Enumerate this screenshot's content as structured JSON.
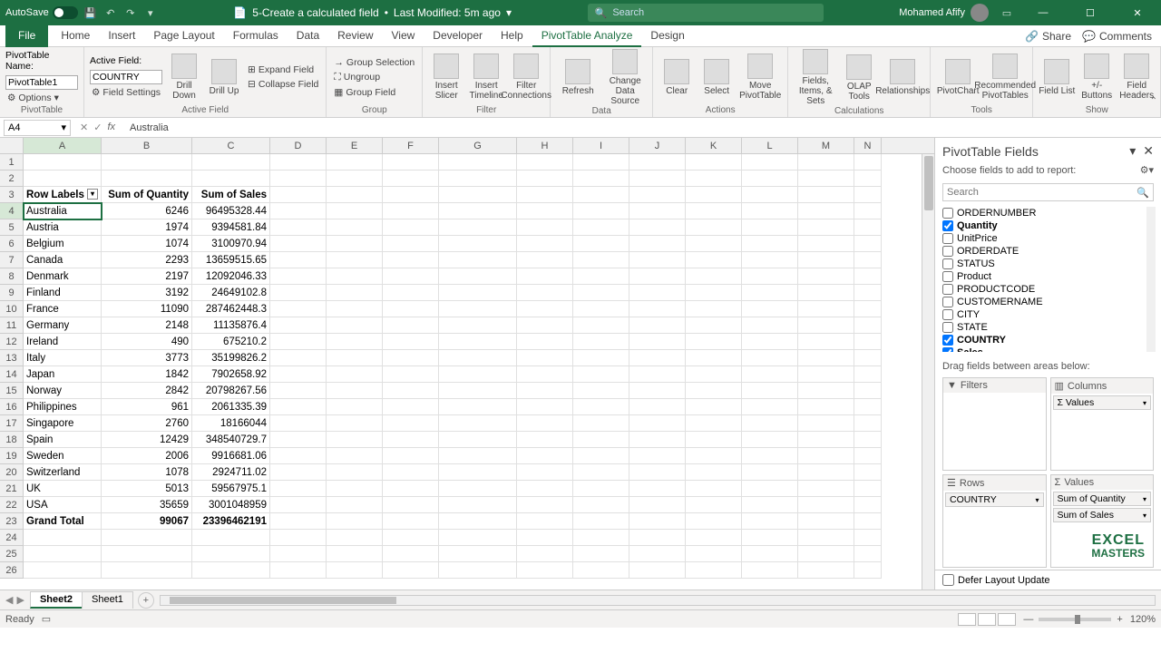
{
  "titlebar": {
    "autosave": "AutoSave",
    "doc_name": "5-Create a calculated field",
    "modified": "Last Modified: 5m ago",
    "search_placeholder": "Search",
    "user_name": "Mohamed Afify"
  },
  "ribbon_tabs": [
    "File",
    "Home",
    "Insert",
    "Page Layout",
    "Formulas",
    "Data",
    "Review",
    "View",
    "Developer",
    "Help",
    "PivotTable Analyze",
    "Design"
  ],
  "active_ribbon_tab": "PivotTable Analyze",
  "ribbon_right": {
    "share": "Share",
    "comments": "Comments"
  },
  "ribbon": {
    "pivot_name_label": "PivotTable Name:",
    "pivot_name_value": "PivotTable1",
    "options_btn": "Options",
    "group1_label": "PivotTable",
    "active_field_label": "Active Field:",
    "active_field_value": "COUNTRY",
    "field_settings": "Field Settings",
    "drill_down": "Drill Down",
    "drill_up": "Drill Up",
    "expand_field": "Expand Field",
    "collapse_field": "Collapse Field",
    "group2_label": "Active Field",
    "group_selection": "Group Selection",
    "ungroup": "Ungroup",
    "group_field": "Group Field",
    "group3_label": "Group",
    "insert_slicer": "Insert Slicer",
    "insert_timeline": "Insert Timeline",
    "filter_conn": "Filter Connections",
    "group4_label": "Filter",
    "refresh": "Refresh",
    "change_ds": "Change Data Source",
    "group5_label": "Data",
    "clear": "Clear",
    "select": "Select",
    "move_pt": "Move PivotTable",
    "group6_label": "Actions",
    "fields_items": "Fields, Items, & Sets",
    "olap": "OLAP Tools",
    "relationships": "Relationships",
    "group7_label": "Calculations",
    "pivotchart": "PivotChart",
    "recommended": "Recommended PivotTables",
    "group8_label": "Tools",
    "field_list": "Field List",
    "buttons": "+/- Buttons",
    "field_headers": "Field Headers",
    "group9_label": "Show"
  },
  "namebox": "A4",
  "formula": "Australia",
  "col_widths": {
    "A": 86,
    "B": 100,
    "C": 86,
    "D": 62,
    "E": 62,
    "F": 62,
    "G": 86,
    "H": 62,
    "I": 62,
    "J": 62,
    "K": 62,
    "L": 62,
    "M": 62,
    "N": 30
  },
  "columns": [
    "A",
    "B",
    "C",
    "D",
    "E",
    "F",
    "G",
    "H",
    "I",
    "J",
    "K",
    "L",
    "M",
    "N"
  ],
  "chart_data": {
    "type": "table",
    "headers": [
      "Row Labels",
      "Sum of Quantity",
      "Sum of Sales"
    ],
    "rows": [
      [
        "Australia",
        6246,
        96495328.44
      ],
      [
        "Austria",
        1974,
        9394581.84
      ],
      [
        "Belgium",
        1074,
        3100970.94
      ],
      [
        "Canada",
        2293,
        13659515.65
      ],
      [
        "Denmark",
        2197,
        12092046.33
      ],
      [
        "Finland",
        3192,
        24649102.8
      ],
      [
        "France",
        11090,
        287462448.3
      ],
      [
        "Germany",
        2148,
        11135876.4
      ],
      [
        "Ireland",
        490,
        675210.2
      ],
      [
        "Italy",
        3773,
        35199826.2
      ],
      [
        "Japan",
        1842,
        7902658.92
      ],
      [
        "Norway",
        2842,
        20798267.56
      ],
      [
        "Philippines",
        961,
        2061335.39
      ],
      [
        "Singapore",
        2760,
        18166044
      ],
      [
        "Spain",
        12429,
        348540729.7
      ],
      [
        "Sweden",
        2006,
        9916681.06
      ],
      [
        "Switzerland",
        1078,
        2924711.02
      ],
      [
        "UK",
        5013,
        59567975.1
      ],
      [
        "USA",
        35659,
        3001048959
      ]
    ],
    "grand_total": [
      "Grand Total",
      99067,
      23396462191
    ]
  },
  "pane": {
    "title": "PivotTable Fields",
    "subtitle": "Choose fields to add to report:",
    "search_placeholder": "Search",
    "fields": [
      {
        "name": "ORDERNUMBER",
        "checked": false
      },
      {
        "name": "Quantity",
        "checked": true
      },
      {
        "name": "UnitPrice",
        "checked": false
      },
      {
        "name": "ORDERDATE",
        "checked": false
      },
      {
        "name": "STATUS",
        "checked": false
      },
      {
        "name": "Product",
        "checked": false
      },
      {
        "name": "PRODUCTCODE",
        "checked": false
      },
      {
        "name": "CUSTOMERNAME",
        "checked": false
      },
      {
        "name": "CITY",
        "checked": false
      },
      {
        "name": "STATE",
        "checked": false
      },
      {
        "name": "COUNTRY",
        "checked": true
      },
      {
        "name": "Sales",
        "checked": true
      }
    ],
    "drag_label": "Drag fields between areas below:",
    "areas": {
      "filters": {
        "label": "Filters",
        "items": []
      },
      "columns": {
        "label": "Columns",
        "items": [
          "Σ Values"
        ]
      },
      "rows": {
        "label": "Rows",
        "items": [
          "COUNTRY"
        ]
      },
      "values": {
        "label": "Values",
        "items": [
          "Sum of Quantity",
          "Sum of Sales"
        ]
      }
    },
    "defer": "Defer Layout Update"
  },
  "sheets": {
    "active": "Sheet2",
    "tabs": [
      "Sheet2",
      "Sheet1"
    ]
  },
  "status": {
    "ready": "Ready",
    "zoom": "120%"
  },
  "watermark": {
    "l1": "EXCEL",
    "l2": "MASTERS"
  }
}
